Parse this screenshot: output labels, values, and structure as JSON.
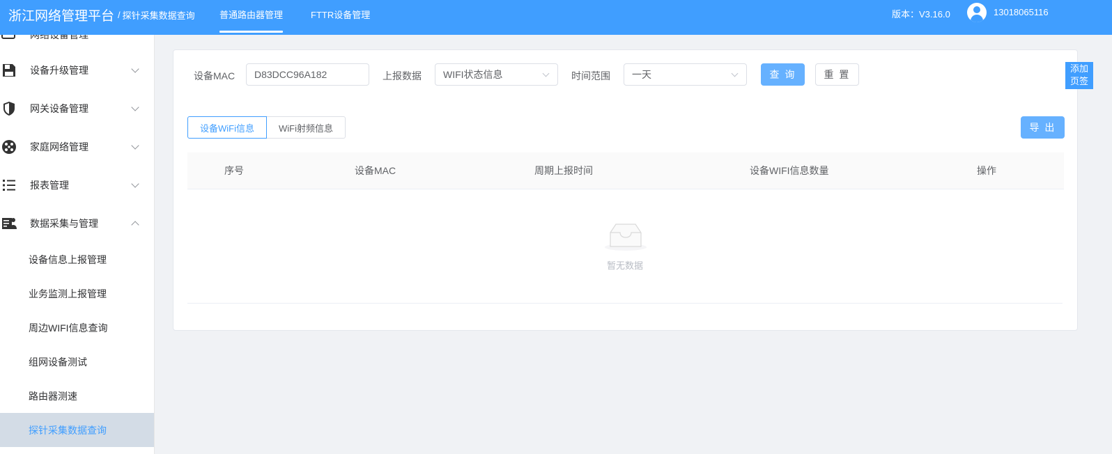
{
  "header": {
    "app_title": "浙江网络管理平台",
    "separator": "/",
    "breadcrumb": "探针采集数据查询",
    "nav": [
      {
        "label": "普通路由器管理",
        "active": true
      },
      {
        "label": "FTTR设备管理",
        "active": false
      }
    ],
    "version": "版本：V3.16.0",
    "username": "13018065116",
    "accent_color": "#409eff"
  },
  "sidebar": {
    "truncated_item": {
      "label": "网络设备管理",
      "icon": "monitor-icon"
    },
    "menu": [
      {
        "label": "设备升级管理",
        "icon": "floppy-icon",
        "expanded": false
      },
      {
        "label": "网关设备管理",
        "icon": "shield-icon",
        "expanded": false
      },
      {
        "label": "家庭网络管理",
        "icon": "network-icon",
        "expanded": false
      },
      {
        "label": "报表管理",
        "icon": "list-icon",
        "expanded": false
      },
      {
        "label": "数据采集与管理",
        "icon": "data-collect-icon",
        "expanded": true
      }
    ],
    "submenu": [
      {
        "label": "设备信息上报管理",
        "active": false
      },
      {
        "label": "业务监测上报管理",
        "active": false
      },
      {
        "label": "周边WIFI信息查询",
        "active": false
      },
      {
        "label": "组网设备测试",
        "active": false
      },
      {
        "label": "路由器测速",
        "active": false
      },
      {
        "label": "探针采集数据查询",
        "active": true
      }
    ]
  },
  "filters": {
    "mac_label": "设备MAC",
    "mac_value": "D83DCC96A182",
    "report_label": "上报数据",
    "report_value": "WIFI状态信息",
    "time_label": "时间范围",
    "time_value": "一天",
    "query_button": "查 询",
    "reset_button": "重 置"
  },
  "tabs": [
    {
      "label": "设备WiFi信息",
      "active": true
    },
    {
      "label": "WiFi射频信息",
      "active": false
    }
  ],
  "export_button": "导 出",
  "table": {
    "columns": [
      "序号",
      "设备MAC",
      "周期上报时间",
      "设备WIFI信息数量",
      "操作"
    ],
    "rows": [],
    "empty_text": "暂无数据"
  },
  "add_tab": {
    "line1": "添加",
    "line2": "页签"
  }
}
